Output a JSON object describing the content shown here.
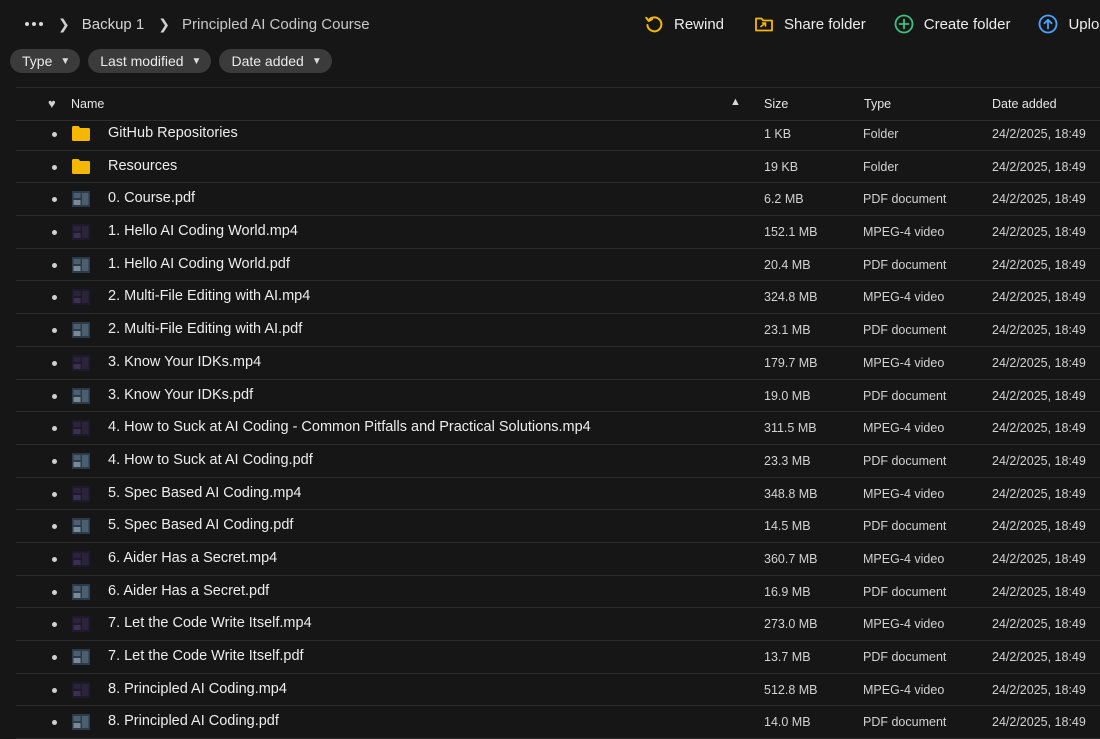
{
  "breadcrumb": {
    "items": [
      "Backup 1",
      "Principled AI Coding Course"
    ]
  },
  "toolbar": {
    "rewind_label": "Rewind",
    "share_label": "Share folder",
    "create_label": "Create folder",
    "upload_label": "Uploa"
  },
  "filters": {
    "type_label": "Type",
    "modified_label": "Last modified",
    "added_label": "Date added"
  },
  "columns": {
    "name": "Name",
    "size": "Size",
    "type": "Type",
    "date": "Date added"
  },
  "colors": {
    "accent_yellow": "#f5b800",
    "accent_green": "#3fbf7f",
    "accent_blue": "#4aa3ff",
    "background": "#161616"
  },
  "files": [
    {
      "name": "GitHub Repositories",
      "size": "1 KB",
      "type": "Folder",
      "date": "24/2/2025, 18:49",
      "icon": "folder-icon"
    },
    {
      "name": "Resources",
      "size": "19 KB",
      "type": "Folder",
      "date": "24/2/2025, 18:49",
      "icon": "folder-icon"
    },
    {
      "name": "0. Course.pdf",
      "size": "6.2 MB",
      "type": "PDF document",
      "date": "24/2/2025, 18:49",
      "icon": "pdf-thumbnail"
    },
    {
      "name": "1. Hello AI Coding World.mp4",
      "size": "152.1 MB",
      "type": "MPEG-4 video",
      "date": "24/2/2025, 18:49",
      "icon": "video-thumbnail"
    },
    {
      "name": "1. Hello AI Coding World.pdf",
      "size": "20.4 MB",
      "type": "PDF document",
      "date": "24/2/2025, 18:49",
      "icon": "pdf-thumbnail"
    },
    {
      "name": "2. Multi-File Editing with AI.mp4",
      "size": "324.8 MB",
      "type": "MPEG-4 video",
      "date": "24/2/2025, 18:49",
      "icon": "video-thumbnail"
    },
    {
      "name": "2. Multi-File Editing with AI.pdf",
      "size": "23.1 MB",
      "type": "PDF document",
      "date": "24/2/2025, 18:49",
      "icon": "pdf-thumbnail"
    },
    {
      "name": "3. Know Your IDKs.mp4",
      "size": "179.7 MB",
      "type": "MPEG-4 video",
      "date": "24/2/2025, 18:49",
      "icon": "video-thumbnail"
    },
    {
      "name": "3. Know Your IDKs.pdf",
      "size": "19.0 MB",
      "type": "PDF document",
      "date": "24/2/2025, 18:49",
      "icon": "pdf-thumbnail"
    },
    {
      "name": "4. How to Suck at AI Coding - Common Pitfalls and Practical Solutions.mp4",
      "size": "311.5 MB",
      "type": "MPEG-4 video",
      "date": "24/2/2025, 18:49",
      "icon": "video-thumbnail"
    },
    {
      "name": "4. How to Suck at AI Coding.pdf",
      "size": "23.3 MB",
      "type": "PDF document",
      "date": "24/2/2025, 18:49",
      "icon": "pdf-thumbnail"
    },
    {
      "name": "5. Spec Based AI Coding.mp4",
      "size": "348.8 MB",
      "type": "MPEG-4 video",
      "date": "24/2/2025, 18:49",
      "icon": "video-thumbnail"
    },
    {
      "name": "5. Spec Based AI Coding.pdf",
      "size": "14.5 MB",
      "type": "PDF document",
      "date": "24/2/2025, 18:49",
      "icon": "pdf-thumbnail"
    },
    {
      "name": "6. Aider Has a Secret.mp4",
      "size": "360.7 MB",
      "type": "MPEG-4 video",
      "date": "24/2/2025, 18:49",
      "icon": "video-thumbnail"
    },
    {
      "name": "6. Aider Has a Secret.pdf",
      "size": "16.9 MB",
      "type": "PDF document",
      "date": "24/2/2025, 18:49",
      "icon": "pdf-thumbnail"
    },
    {
      "name": "7. Let the Code Write Itself.mp4",
      "size": "273.0 MB",
      "type": "MPEG-4 video",
      "date": "24/2/2025, 18:49",
      "icon": "video-thumbnail"
    },
    {
      "name": "7. Let the Code Write Itself.pdf",
      "size": "13.7 MB",
      "type": "PDF document",
      "date": "24/2/2025, 18:49",
      "icon": "pdf-thumbnail"
    },
    {
      "name": "8. Principled AI Coding.mp4",
      "size": "512.8 MB",
      "type": "MPEG-4 video",
      "date": "24/2/2025, 18:49",
      "icon": "video-thumbnail"
    },
    {
      "name": "8. Principled AI Coding.pdf",
      "size": "14.0 MB",
      "type": "PDF document",
      "date": "24/2/2025, 18:49",
      "icon": "pdf-thumbnail"
    }
  ]
}
